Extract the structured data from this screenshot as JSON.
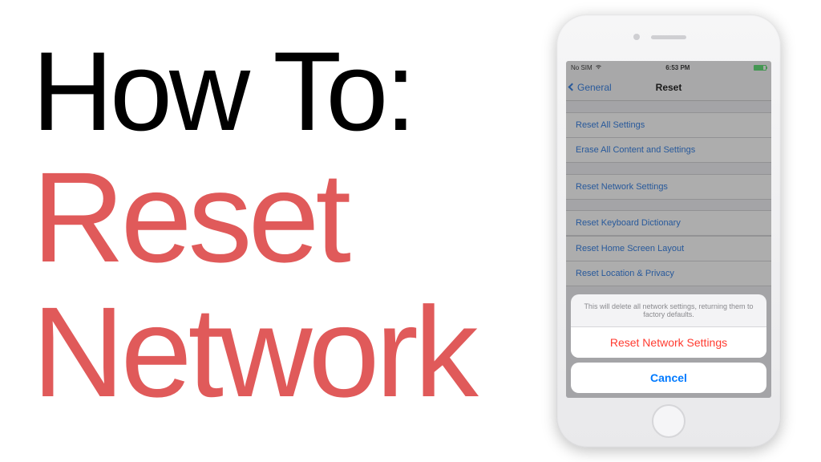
{
  "title": {
    "line1": "How To:",
    "line2": "Reset",
    "line3": "Network"
  },
  "phone": {
    "statusbar": {
      "carrier": "No SIM",
      "time": "6:53 PM"
    },
    "nav": {
      "back_label": "General",
      "title": "Reset"
    },
    "reset_options": {
      "group1": [
        "Reset All Settings",
        "Erase All Content and Settings"
      ],
      "group2": [
        "Reset Network Settings"
      ],
      "group3": [
        "Reset Keyboard Dictionary",
        "Reset Home Screen Layout",
        "Reset Location & Privacy"
      ]
    },
    "action_sheet": {
      "message": "This will delete all network settings, returning them to factory defaults.",
      "confirm": "Reset Network Settings",
      "cancel": "Cancel"
    }
  }
}
